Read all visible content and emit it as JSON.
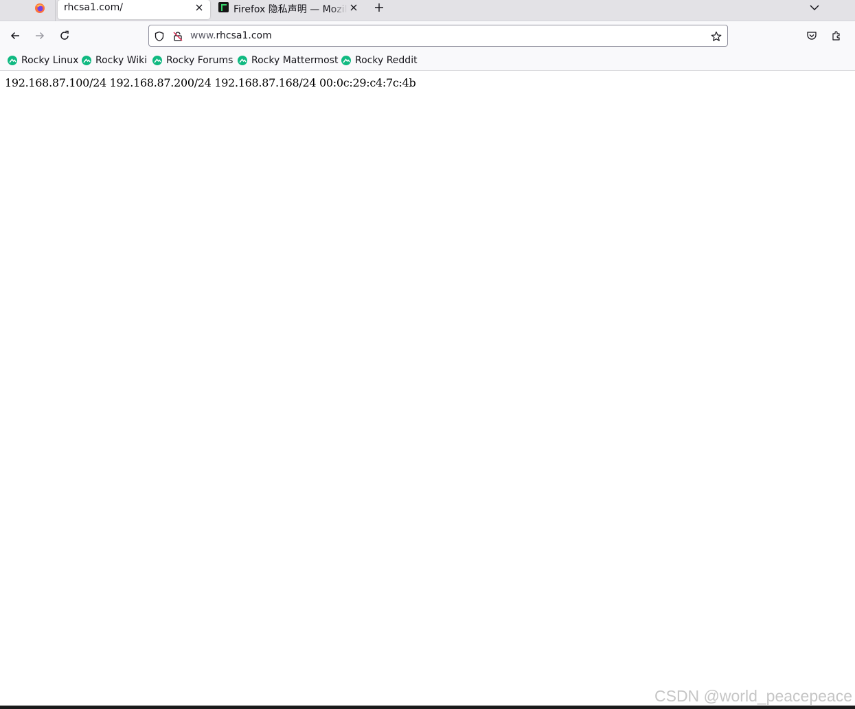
{
  "tabs": [
    {
      "title": "rhcsa1.com/",
      "active": true
    },
    {
      "title": "Firefox 隐私声明 — Mozilla",
      "active": false
    }
  ],
  "url": {
    "prefix": "www.",
    "host": "rhcsa1.com"
  },
  "bookmarks": [
    {
      "label": "Rocky Linux"
    },
    {
      "label": "Rocky Wiki"
    },
    {
      "label": "Rocky Forums"
    },
    {
      "label": "Rocky Mattermost"
    },
    {
      "label": "Rocky Reddit"
    }
  ],
  "page": {
    "text": "192.168.87.100/24 192.168.87.200/24 192.168.87.168/24 00:0c:29:c4:7c:4b"
  },
  "watermark": "CSDN @world_peacepeace",
  "colors": {
    "rocky_green": "#10b981",
    "firefox_orange": "#ff7139"
  }
}
